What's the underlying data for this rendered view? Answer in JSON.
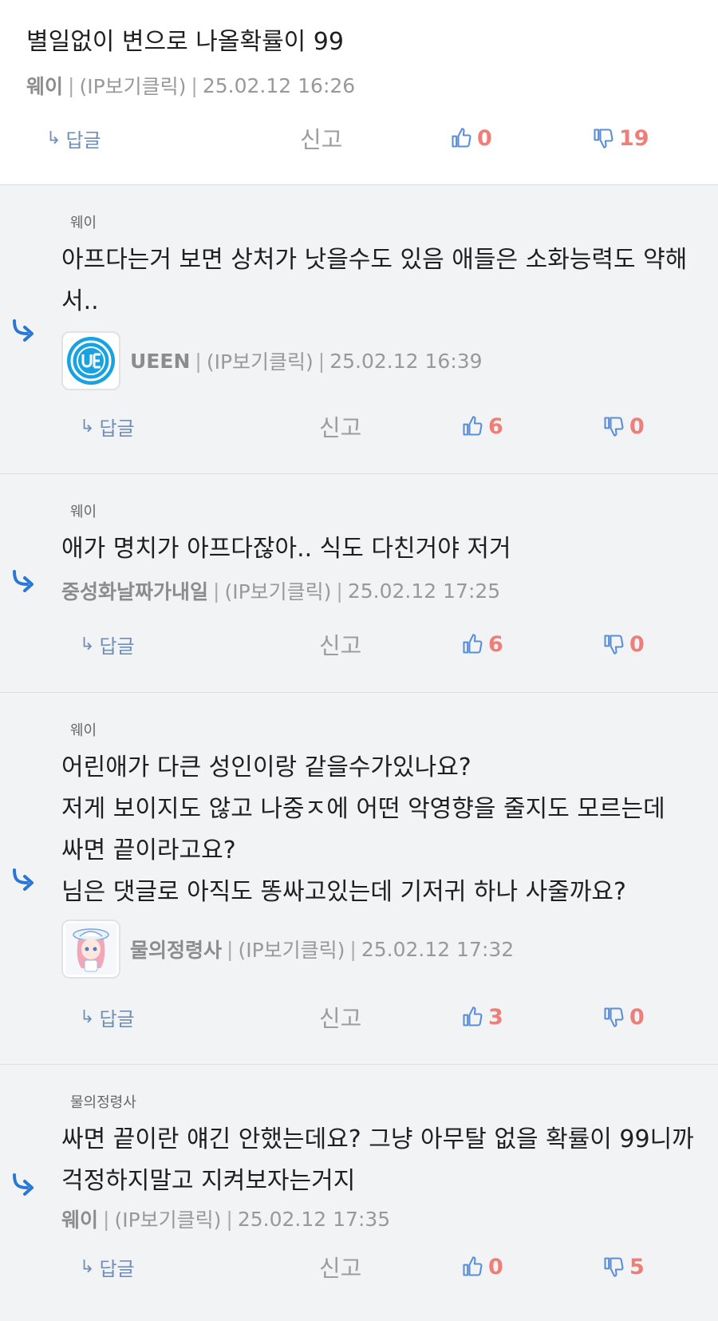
{
  "ui": {
    "reply_label": "답글",
    "report_label": "신고",
    "ip_label": "(IP보기클릭)",
    "separator": "|",
    "colors": {
      "count": "#ee7e78",
      "thumb_icon": "#5a8fd6",
      "reply_arrow": "#2a78d6",
      "reply_link": "#6f8fb8"
    }
  },
  "comments": [
    {
      "text": "별일없이 변으로 나올확률이 99",
      "author": "웨이",
      "date": "25.02.12 16:26",
      "likes": "0",
      "dislikes": "19"
    },
    {
      "reply_to": "웨이",
      "text": "아프다는거 보면 상처가 낫을수도 있음 애들은 소화능력도 약해서..",
      "author": "UEEN",
      "avatar": "ueen-logo-icon",
      "date": "25.02.12 16:39",
      "likes": "6",
      "dislikes": "0"
    },
    {
      "reply_to": "웨이",
      "text": "애가 명치가 아프다잖아.. 식도 다친거야 저거",
      "author": "중성화날짜가내일",
      "date": "25.02.12 17:25",
      "likes": "6",
      "dislikes": "0"
    },
    {
      "reply_to": "웨이",
      "text": "어린애가 다큰 성인이랑 같을수가있나요?\n저게 보이지도 않고 나중ㅈ에 어떤 악영향을 줄지도 모르는데 싸면 끝이라고요?\n님은 댓글로 아직도 똥싸고있는데 기저귀 하나 사줄까요?",
      "author": "물의정령사",
      "avatar": "anime-girl-avatar-icon",
      "date": "25.02.12 17:32",
      "likes": "3",
      "dislikes": "0"
    },
    {
      "reply_to": "물의정령사",
      "text": "싸면 끝이란 얘긴 안했는데요? 그냥 아무탈 없을 확률이 99니까 걱정하지말고 지켜보자는거지",
      "author": "웨이",
      "date": "25.02.12 17:35",
      "likes": "0",
      "dislikes": "5"
    }
  ]
}
